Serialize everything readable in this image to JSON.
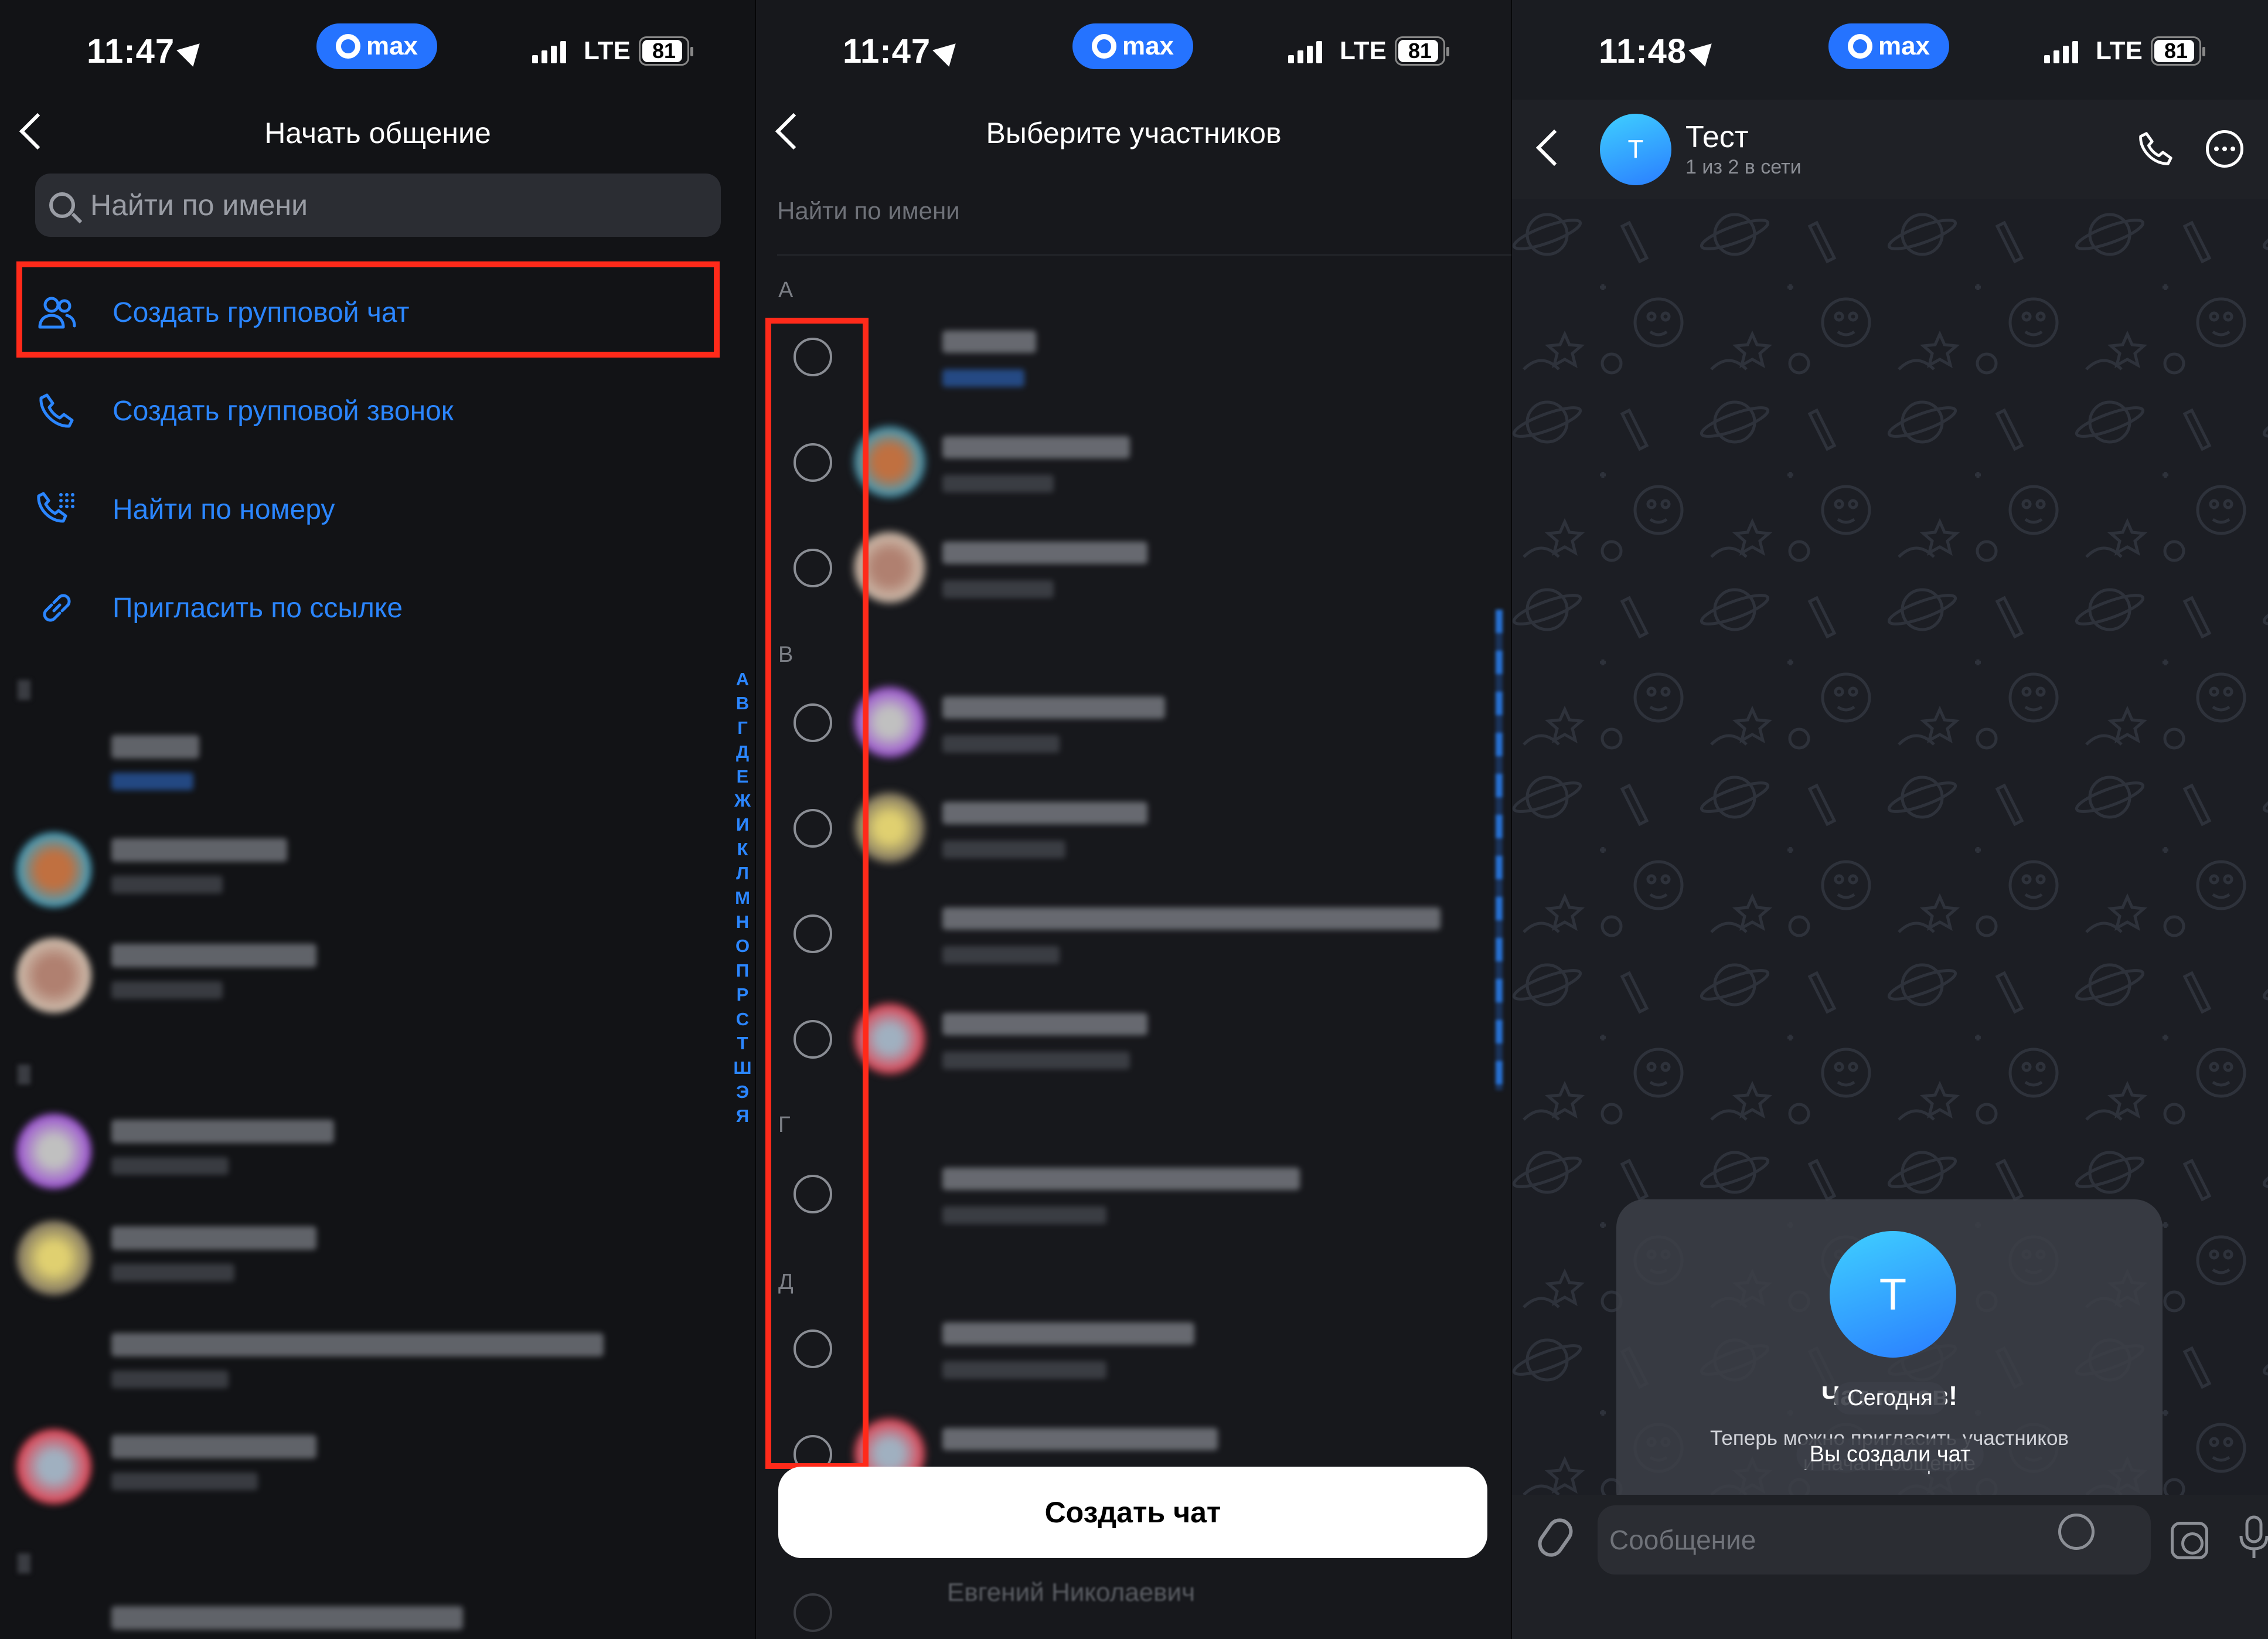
{
  "status_bar": {
    "panel1_time": "11:47",
    "panel2_time": "11:47",
    "panel3_time": "11:48",
    "max_label": "max",
    "network": "LTE",
    "battery": "81"
  },
  "panel1": {
    "title": "Начать общение",
    "search_placeholder": "Найти по имени",
    "actions": [
      {
        "label": "Создать групповой чат",
        "icon": "group-icon"
      },
      {
        "label": "Создать групповой звонок",
        "icon": "phone-icon"
      },
      {
        "label": "Найти по номеру",
        "icon": "dialpad-icon"
      },
      {
        "label": "Пригласить по ссылке",
        "icon": "link-icon"
      }
    ],
    "alphabet_index": [
      "А",
      "В",
      "Г",
      "Д",
      "Е",
      "Ж",
      "И",
      "К",
      "Л",
      "М",
      "Н",
      "О",
      "П",
      "Р",
      "С",
      "Т",
      "Ш",
      "Э",
      "Я"
    ]
  },
  "panel2": {
    "title": "Выберите участников",
    "search_placeholder": "Найти по имени",
    "sections": [
      "А",
      "В",
      "Г",
      "Д"
    ],
    "create_button": "Создать чат",
    "partial_row_name": "Евгений Николаевич"
  },
  "panel3": {
    "chat_name": "Тест",
    "avatar_letter": "T",
    "chat_status": "1 из 2 в сети",
    "ready_title": "Чат готов!",
    "ready_subtitle_line1": "Теперь можно пригласить участников",
    "ready_subtitle_line2": "и начать общение",
    "date_chip": "Сегодня",
    "system_msg": "Вы создали чат",
    "composer_placeholder": "Сообщение"
  },
  "colors": {
    "accent": "#2B86FF",
    "highlight": "#FF2A1A",
    "background": "#121316",
    "avatar_gradient_start": "#3FD0FF",
    "avatar_gradient_end": "#2A7DFF"
  }
}
